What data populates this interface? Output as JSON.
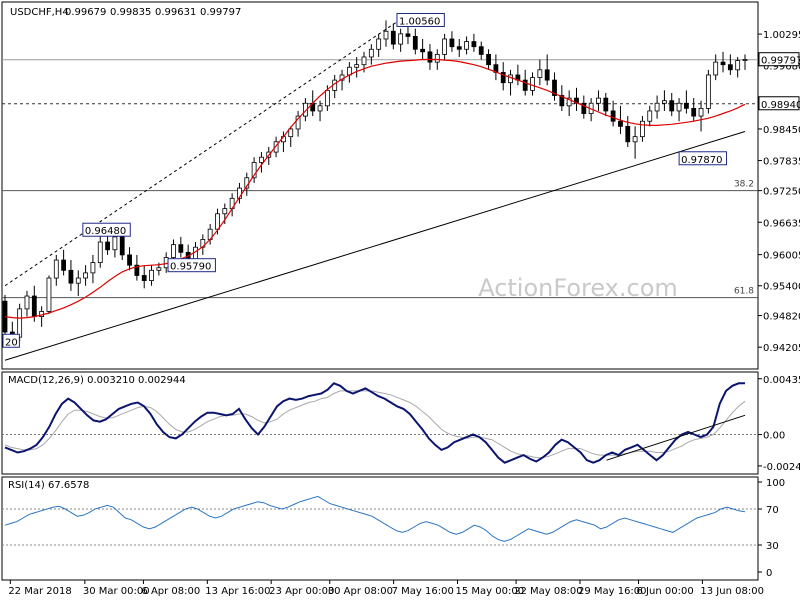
{
  "chart_data": {
    "type": "candlestick",
    "header": {
      "symbol": "USDCHF,H4",
      "ohlc": [
        "0.99679",
        "0.99835",
        "0.99631",
        "0.99797"
      ]
    },
    "watermark": "ActionForex.com",
    "price_axis": {
      "ylim": [
        0.938,
        1.009
      ],
      "ticks": [
        "1.00295",
        "0.99680",
        "0.99065",
        "0.98450",
        "0.97835",
        "0.97220",
        "0.96605",
        "0.95990",
        "0.95375",
        "0.94760",
        "0.94145"
      ],
      "tick_values": [
        1.00295,
        0.9968,
        0.99065,
        0.9845,
        0.97835,
        0.9722,
        0.96605,
        0.9599,
        0.95375,
        0.9476,
        0.94145
      ],
      "printed_ticks": [
        "1.00295",
        "0.99680",
        "0.98450",
        "0.97835",
        "0.97250",
        "0.96635",
        "0.96005",
        "0.95400",
        "0.94820",
        "0.94205"
      ],
      "printed_values": [
        1.00295,
        0.9968,
        0.9845,
        0.97835,
        0.9725,
        0.96635,
        0.96005,
        0.954,
        0.9482,
        0.94205
      ]
    },
    "current_price": "0.99797",
    "level_line": "0.98940",
    "fib_levels": [
      {
        "label": "38.2",
        "value": 0.9725
      },
      {
        "label": "61.8",
        "value": 0.9517
      }
    ],
    "annotations": [
      {
        "text": "1.00560",
        "x": 74,
        "value": 1.0056
      },
      {
        "text": "0.96480",
        "x": 15,
        "value": 0.9648
      },
      {
        "text": "0.95790",
        "x": 31,
        "value": 0.9579
      },
      {
        "text": "0.97870",
        "x": 127,
        "value": 0.9787
      },
      {
        "text": "20",
        "x": 0,
        "value": 0.9432
      }
    ],
    "x_labels": [
      {
        "text": "22 Mar 2018",
        "x": 1
      },
      {
        "text": "30 Mar 00:00",
        "x": 15
      },
      {
        "text": "6 Apr 08:00",
        "x": 26
      },
      {
        "text": "13 Apr 16:00",
        "x": 38
      },
      {
        "text": "23 Apr 00:00",
        "x": 50
      },
      {
        "text": "30 Apr 08:00",
        "x": 61
      },
      {
        "text": "7 May 16:00",
        "x": 73
      },
      {
        "text": "15 May 00:00",
        "x": 85
      },
      {
        "text": "22 May 08:00",
        "x": 96
      },
      {
        "text": "29 May 16:00",
        "x": 108
      },
      {
        "text": "6 Jun 00:00",
        "x": 119
      },
      {
        "text": "13 Jun 08:00",
        "x": 131
      }
    ],
    "candles": [
      [
        0.951,
        0.9522,
        0.944,
        0.945
      ],
      [
        0.945,
        0.947,
        0.942,
        0.944
      ],
      [
        0.944,
        0.9505,
        0.9432,
        0.9495
      ],
      [
        0.9495,
        0.953,
        0.948,
        0.952
      ],
      [
        0.952,
        0.954,
        0.947,
        0.948
      ],
      [
        0.948,
        0.95,
        0.946,
        0.949
      ],
      [
        0.949,
        0.956,
        0.9485,
        0.9555
      ],
      [
        0.9555,
        0.96,
        0.954,
        0.959
      ],
      [
        0.959,
        0.961,
        0.956,
        0.957
      ],
      [
        0.957,
        0.959,
        0.953,
        0.9545
      ],
      [
        0.9545,
        0.957,
        0.952,
        0.9555
      ],
      [
        0.9555,
        0.958,
        0.954,
        0.9565
      ],
      [
        0.9565,
        0.96,
        0.9545,
        0.9585
      ],
      [
        0.9585,
        0.964,
        0.9575,
        0.9625
      ],
      [
        0.9625,
        0.965,
        0.96,
        0.961
      ],
      [
        0.961,
        0.9648,
        0.9595,
        0.9635
      ],
      [
        0.9635,
        0.964,
        0.959,
        0.96
      ],
      [
        0.96,
        0.9615,
        0.957,
        0.958
      ],
      [
        0.958,
        0.96,
        0.955,
        0.956
      ],
      [
        0.956,
        0.958,
        0.9535,
        0.955
      ],
      [
        0.955,
        0.958,
        0.954,
        0.957
      ],
      [
        0.957,
        0.9585,
        0.956,
        0.9575
      ],
      [
        0.9575,
        0.9605,
        0.9565,
        0.9595
      ],
      [
        0.9595,
        0.963,
        0.9585,
        0.962
      ],
      [
        0.962,
        0.9635,
        0.9595,
        0.9605
      ],
      [
        0.9605,
        0.962,
        0.9579,
        0.959
      ],
      [
        0.959,
        0.9625,
        0.9585,
        0.9615
      ],
      [
        0.9615,
        0.964,
        0.96,
        0.963
      ],
      [
        0.963,
        0.966,
        0.962,
        0.965
      ],
      [
        0.965,
        0.969,
        0.964,
        0.968
      ],
      [
        0.968,
        0.97,
        0.966,
        0.969
      ],
      [
        0.969,
        0.972,
        0.9675,
        0.971
      ],
      [
        0.971,
        0.974,
        0.97,
        0.973
      ],
      [
        0.973,
        0.976,
        0.9715,
        0.975
      ],
      [
        0.975,
        0.979,
        0.974,
        0.978
      ],
      [
        0.978,
        0.98,
        0.976,
        0.979
      ],
      [
        0.979,
        0.981,
        0.9775,
        0.98
      ],
      [
        0.98,
        0.983,
        0.979,
        0.982
      ],
      [
        0.982,
        0.984,
        0.98,
        0.983
      ],
      [
        0.983,
        0.985,
        0.981,
        0.9845
      ],
      [
        0.9845,
        0.988,
        0.983,
        0.987
      ],
      [
        0.987,
        0.9905,
        0.986,
        0.9895
      ],
      [
        0.9895,
        0.992,
        0.987,
        0.988
      ],
      [
        0.988,
        0.99,
        0.986,
        0.989
      ],
      [
        0.989,
        0.993,
        0.988,
        0.992
      ],
      [
        0.992,
        0.995,
        0.9905,
        0.994
      ],
      [
        0.994,
        0.996,
        0.992,
        0.995
      ],
      [
        0.995,
        0.9975,
        0.9935,
        0.9965
      ],
      [
        0.9965,
        0.9985,
        0.9945,
        0.997
      ],
      [
        0.997,
        0.9995,
        0.9955,
        0.9985
      ],
      [
        0.9985,
        1.001,
        0.997,
        1.0
      ],
      [
        1.0,
        1.003,
        0.9985,
        1.002
      ],
      [
        1.002,
        1.0056,
        1.0005,
        1.0035
      ],
      [
        1.0035,
        1.005,
        1.0,
        1.001
      ],
      [
        1.001,
        1.004,
        0.9995,
        1.003
      ],
      [
        1.003,
        1.005,
        1.001,
        1.0025
      ],
      [
        1.0025,
        1.004,
        0.999,
        1.0
      ],
      [
        1.0,
        1.002,
        0.998,
        0.9995
      ],
      [
        0.9995,
        1.001,
        0.996,
        0.9975
      ],
      [
        0.9975,
        1.0,
        0.996,
        0.999
      ],
      [
        0.999,
        1.003,
        0.998,
        1.002
      ],
      [
        1.002,
        1.0035,
        0.9995,
        1.0005
      ],
      [
        1.0005,
        1.002,
        0.9985,
        1.0
      ],
      [
        1.0,
        1.0025,
        0.999,
        1.0015
      ],
      [
        1.0015,
        1.003,
        0.9995,
        1.0005
      ],
      [
        1.0005,
        1.0015,
        0.998,
        0.999
      ],
      [
        0.999,
        1.0,
        0.996,
        0.997
      ],
      [
        0.997,
        0.999,
        0.994,
        0.9955
      ],
      [
        0.9955,
        0.9975,
        0.992,
        0.9935
      ],
      [
        0.9935,
        0.996,
        0.991,
        0.995
      ],
      [
        0.995,
        0.997,
        0.993,
        0.994
      ],
      [
        0.994,
        0.996,
        0.991,
        0.992
      ],
      [
        0.992,
        0.9955,
        0.991,
        0.9945
      ],
      [
        0.9945,
        0.998,
        0.993,
        0.996
      ],
      [
        0.996,
        0.999,
        0.993,
        0.994
      ],
      [
        0.994,
        0.9955,
        0.99,
        0.991
      ],
      [
        0.991,
        0.993,
        0.988,
        0.989
      ],
      [
        0.989,
        0.992,
        0.987,
        0.9905
      ],
      [
        0.9905,
        0.9925,
        0.988,
        0.9895
      ],
      [
        0.9895,
        0.991,
        0.9865,
        0.9875
      ],
      [
        0.9875,
        0.9905,
        0.986,
        0.9895
      ],
      [
        0.9895,
        0.992,
        0.988,
        0.9905
      ],
      [
        0.9905,
        0.9915,
        0.987,
        0.988
      ],
      [
        0.988,
        0.99,
        0.985,
        0.986
      ],
      [
        0.986,
        0.989,
        0.9835,
        0.985
      ],
      [
        0.985,
        0.987,
        0.981,
        0.982
      ],
      [
        0.982,
        0.985,
        0.9787,
        0.983
      ],
      [
        0.983,
        0.987,
        0.982,
        0.986
      ],
      [
        0.986,
        0.989,
        0.985,
        0.988
      ],
      [
        0.988,
        0.991,
        0.9865,
        0.9895
      ],
      [
        0.9895,
        0.992,
        0.988,
        0.99
      ],
      [
        0.99,
        0.9915,
        0.987,
        0.988
      ],
      [
        0.988,
        0.9905,
        0.986,
        0.9895
      ],
      [
        0.9895,
        0.992,
        0.9875,
        0.9885
      ],
      [
        0.9885,
        0.9905,
        0.986,
        0.987
      ],
      [
        0.987,
        0.99,
        0.984,
        0.9885
      ],
      [
        0.9885,
        0.996,
        0.9875,
        0.995
      ],
      [
        0.995,
        0.999,
        0.994,
        0.9975
      ],
      [
        0.9975,
        0.9995,
        0.9955,
        0.997
      ],
      [
        0.997,
        0.999,
        0.995,
        0.996
      ],
      [
        0.996,
        0.9985,
        0.9945,
        0.9978
      ],
      [
        0.9978,
        0.999,
        0.996,
        0.998
      ]
    ],
    "ma": {
      "name": "",
      "color": "#e00000",
      "values": [
        0.948,
        0.9478,
        0.9477,
        0.9478,
        0.948,
        0.9483,
        0.9487,
        0.9492,
        0.9497,
        0.9503,
        0.951,
        0.9518,
        0.9527,
        0.9537,
        0.9548,
        0.9558,
        0.9567,
        0.9573,
        0.9577,
        0.9579,
        0.958,
        0.9581,
        0.9583,
        0.9587,
        0.9592,
        0.9598,
        0.9606,
        0.9616,
        0.963,
        0.9648,
        0.9668,
        0.969,
        0.9712,
        0.9734,
        0.9755,
        0.9775,
        0.9794,
        0.9812,
        0.983,
        0.9848,
        0.9865,
        0.988,
        0.9895,
        0.9909,
        0.9922,
        0.9933,
        0.9942,
        0.995,
        0.9957,
        0.9962,
        0.9967,
        0.997,
        0.9973,
        0.9975,
        0.9977,
        0.9978,
        0.9979,
        0.998,
        0.998,
        0.998,
        0.9979,
        0.9978,
        0.9976,
        0.9973,
        0.997,
        0.9966,
        0.9961,
        0.9956,
        0.995,
        0.9945,
        0.994,
        0.9935,
        0.993,
        0.9925,
        0.992,
        0.9914,
        0.9908,
        0.9902,
        0.9896,
        0.989,
        0.9884,
        0.9878,
        0.9872,
        0.9867,
        0.9862,
        0.9858,
        0.9855,
        0.9853,
        0.9852,
        0.9852,
        0.9853,
        0.9854,
        0.9856,
        0.9858,
        0.986,
        0.9863,
        0.9866,
        0.987,
        0.9875,
        0.988,
        0.9886,
        0.9893
      ]
    },
    "trendlines": [
      {
        "name": "lower",
        "style": "solid",
        "from": [
          0,
          0.9395
        ],
        "to": [
          139,
          0.984
        ]
      },
      {
        "name": "upper",
        "style": "dashed",
        "from": [
          0,
          0.954
        ],
        "to": [
          74,
          1.0056
        ]
      }
    ],
    "macd_panel": {
      "label": "MACD(12,26,9) 0.003210 0.002944",
      "ylim": [
        -0.003,
        0.0048
      ],
      "ticks": [
        "0.004351",
        "0.00",
        "-0.002448"
      ],
      "tick_values": [
        0.004351,
        0.0,
        -0.002448
      ],
      "values": [
        -0.001,
        -0.0012,
        -0.0014,
        -0.0013,
        -0.0011,
        -0.0008,
        -0.0002,
        0.0006,
        0.0016,
        0.0024,
        0.0028,
        0.0025,
        0.002,
        0.0015,
        0.0011,
        0.001,
        0.0012,
        0.0016,
        0.002,
        0.0022,
        0.0024,
        0.0025,
        0.0022,
        0.0016,
        0.0008,
        0.0002,
        -0.0002,
        -0.0003,
        0.0,
        0.0005,
        0.001,
        0.0014,
        0.0017,
        0.0017,
        0.0016,
        0.0015,
        0.0016,
        0.002,
        0.0012,
        0.0005,
        0.0,
        0.0006,
        0.0014,
        0.0022,
        0.0026,
        0.0028,
        0.0027,
        0.0028,
        0.003,
        0.0031,
        0.0032,
        0.0035,
        0.004,
        0.0038,
        0.0034,
        0.0032,
        0.0034,
        0.0036,
        0.0033,
        0.003,
        0.0028,
        0.0025,
        0.0022,
        0.002,
        0.0016,
        0.001,
        0.0004,
        -0.0003,
        -0.0008,
        -0.0012,
        -0.001,
        -0.0006,
        -0.0004,
        -0.0002,
        0.0,
        -0.0002,
        -0.0006,
        -0.0012,
        -0.0018,
        -0.0022,
        -0.002,
        -0.0018,
        -0.0016,
        -0.0019,
        -0.0021,
        -0.0018,
        -0.0014,
        -0.0008,
        -0.0004,
        -0.0006,
        -0.001,
        -0.0014,
        -0.002,
        -0.0022,
        -0.002,
        -0.0016,
        -0.0014,
        -0.0016,
        -0.0012,
        -0.001,
        -0.0008,
        -0.0012,
        -0.0016,
        -0.002,
        -0.0016,
        -0.001,
        -0.0004,
        0.0,
        0.0002,
        0.0,
        -0.0002,
        0.0,
        0.0006,
        0.0024,
        0.0034,
        0.0038,
        0.004,
        0.004
      ],
      "signal": [
        -0.0008,
        -0.001,
        -0.0011,
        -0.0012,
        -0.0012,
        -0.0011,
        -0.0008,
        -0.0003,
        0.0003,
        0.001,
        0.0016,
        0.0019,
        0.0019,
        0.0018,
        0.0016,
        0.0014,
        0.0013,
        0.0013,
        0.0015,
        0.0017,
        0.0019,
        0.0021,
        0.0022,
        0.0021,
        0.0018,
        0.0013,
        0.0008,
        0.0004,
        0.0002,
        0.0002,
        0.0004,
        0.0007,
        0.001,
        0.0012,
        0.0014,
        0.0015,
        0.0015,
        0.0016,
        0.0016,
        0.0014,
        0.0011,
        0.0009,
        0.001,
        0.0012,
        0.0016,
        0.0019,
        0.0021,
        0.0023,
        0.0025,
        0.0026,
        0.0028,
        0.0029,
        0.0032,
        0.0034,
        0.0034,
        0.0034,
        0.0034,
        0.0034,
        0.0034,
        0.0033,
        0.0032,
        0.0031,
        0.0029,
        0.0027,
        0.0025,
        0.0022,
        0.0018,
        0.0014,
        0.0009,
        0.0004,
        0.0001,
        -0.0001,
        -0.0002,
        -0.0003,
        -0.0002,
        -0.0002,
        -0.0003,
        -0.0004,
        -0.0007,
        -0.001,
        -0.0013,
        -0.0015,
        -0.0016,
        -0.0017,
        -0.0018,
        -0.0018,
        -0.0017,
        -0.0015,
        -0.0013,
        -0.0011,
        -0.0011,
        -0.0011,
        -0.0013,
        -0.0015,
        -0.0016,
        -0.0016,
        -0.0016,
        -0.0016,
        -0.0015,
        -0.0014,
        -0.0013,
        -0.0013,
        -0.0013,
        -0.0014,
        -0.0014,
        -0.0013,
        -0.0011,
        -0.0009,
        -0.0006,
        -0.0004,
        -0.0003,
        -0.0002,
        0.0,
        0.0005,
        0.0011,
        0.0017,
        0.0022,
        0.0026
      ],
      "trendline": {
        "from": [
          113,
          -0.002
        ],
        "to": [
          139,
          0.0015
        ]
      }
    },
    "rsi_panel": {
      "label": "RSI(14) 67.6578",
      "ylim": [
        0,
        100
      ],
      "ticks": [
        "100",
        "70",
        "30",
        "0"
      ],
      "tick_values": [
        100,
        70,
        30,
        0
      ],
      "levels": [
        70,
        30
      ],
      "values": [
        52,
        54,
        56,
        60,
        64,
        66,
        68,
        70,
        72,
        73,
        70,
        66,
        62,
        63,
        66,
        70,
        72,
        74,
        72,
        66,
        60,
        58,
        54,
        50,
        48,
        50,
        54,
        58,
        62,
        66,
        70,
        72,
        70,
        66,
        62,
        60,
        62,
        66,
        70,
        72,
        74,
        76,
        78,
        77,
        74,
        72,
        70,
        72,
        75,
        78,
        80,
        82,
        84,
        80,
        76,
        74,
        72,
        70,
        68,
        66,
        64,
        62,
        58,
        54,
        50,
        46,
        44,
        46,
        50,
        54,
        56,
        54,
        52,
        48,
        44,
        42,
        44,
        48,
        52,
        50,
        46,
        40,
        36,
        34,
        36,
        40,
        44,
        48,
        46,
        44,
        42,
        44,
        48,
        52,
        56,
        58,
        56,
        54,
        52,
        48,
        50,
        54,
        58,
        60,
        58,
        56,
        54,
        52,
        50,
        48,
        46,
        44,
        48,
        52,
        56,
        60,
        62,
        64,
        66,
        70,
        72,
        70,
        68,
        67
      ]
    }
  }
}
